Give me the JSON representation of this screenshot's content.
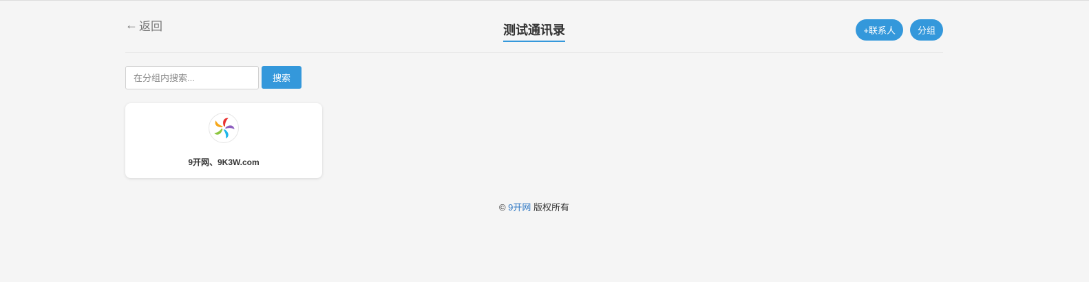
{
  "header": {
    "back_label": "返回",
    "title": "测试通讯录",
    "add_contact_label": "+联系人",
    "group_label": "分组"
  },
  "search": {
    "placeholder": "在分组内搜索...",
    "value": "",
    "button_label": "搜索"
  },
  "contacts": [
    {
      "name": "9开网、9K3W.com",
      "avatar_icon": "pinwheel-logo-icon"
    }
  ],
  "footer": {
    "copyright_symbol": "©",
    "site_link": "9开网",
    "rights_text": "版权所有"
  },
  "colors": {
    "accent": "#3498db",
    "background": "#f5f5f5",
    "link": "#2f78c4"
  }
}
